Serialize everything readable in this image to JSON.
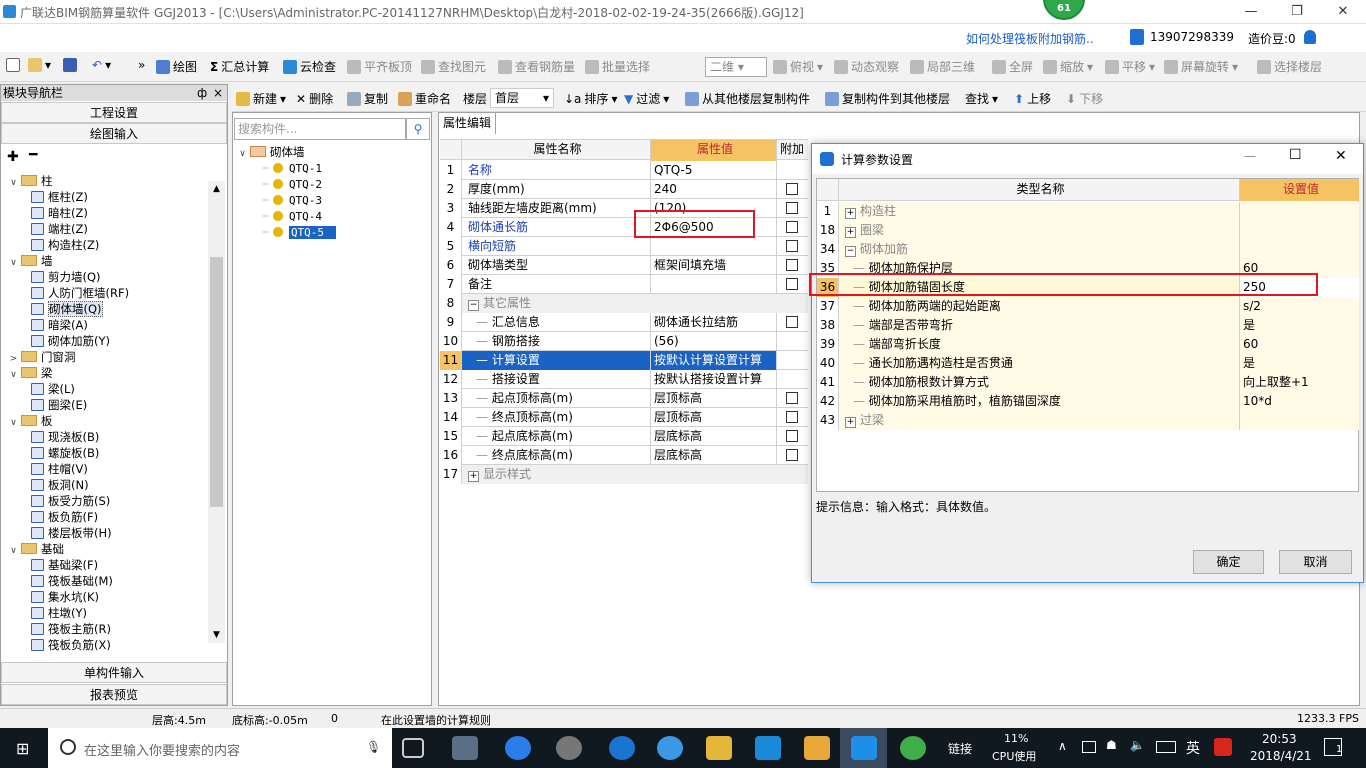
{
  "window": {
    "title": "广联达BIM钢筋算量软件 GGJ2013 - [C:\\Users\\Administrator.PC-20141127NRHM\\Desktop\\白龙村-2018-02-02-19-24-35(2666版).GGJ12]",
    "badge": "61"
  },
  "infobar": {
    "help_link": "如何处理筏板附加钢筋..",
    "phone": "13907298339",
    "bean": "造价豆:0"
  },
  "toolbar1": {
    "draw": "绘图",
    "sum_calc": "汇总计算",
    "cloud_check": "云检查",
    "flat_top": "平齐板顶",
    "find_element": "查找图元",
    "view_rebar": "查看钢筋量",
    "batch_select": "批量选择",
    "view_mode": "二维",
    "top_view": "俯视",
    "dynamic_view": "动态观察",
    "local_3d": "局部三维",
    "fullscreen": "全屏",
    "zoom": "缩放",
    "pan": "平移",
    "rotate": "屏幕旋转",
    "select_floor": "选择楼层"
  },
  "toolbar2": {
    "new": "新建",
    "delete": "删除",
    "copy": "复制",
    "rename": "重命名",
    "floor_label": "楼层",
    "floor_value": "首层",
    "sort": "排序",
    "filter": "过滤",
    "copy_from": "从其他楼层复制构件",
    "copy_to": "复制构件到其他楼层",
    "find": "查找",
    "move_up": "上移",
    "move_down": "下移"
  },
  "nav": {
    "header": "模块导航栏",
    "pin": "ф",
    "close": "×",
    "project_settings": "工程设置",
    "drawing_input": "绘图输入",
    "single_input": "单构件输入",
    "report_preview": "报表预览",
    "tree": [
      {
        "level": 0,
        "exp": "∨",
        "label": "柱",
        "folder": true
      },
      {
        "level": 1,
        "label": "框柱(Z)"
      },
      {
        "level": 1,
        "label": "暗柱(Z)"
      },
      {
        "level": 1,
        "label": "端柱(Z)"
      },
      {
        "level": 1,
        "label": "构造柱(Z)"
      },
      {
        "level": 0,
        "exp": "∨",
        "label": "墙",
        "folder": true
      },
      {
        "level": 1,
        "label": "剪力墙(Q)"
      },
      {
        "level": 1,
        "label": "人防门框墙(RF)"
      },
      {
        "level": 1,
        "label": "砌体墙(Q)",
        "selected": true
      },
      {
        "level": 1,
        "label": "暗梁(A)"
      },
      {
        "level": 1,
        "label": "砌体加筋(Y)"
      },
      {
        "level": 0,
        "exp": ">",
        "label": "门窗洞",
        "folder": true
      },
      {
        "level": 0,
        "exp": "∨",
        "label": "梁",
        "folder": true
      },
      {
        "level": 1,
        "label": "梁(L)"
      },
      {
        "level": 1,
        "label": "圈梁(E)"
      },
      {
        "level": 0,
        "exp": "∨",
        "label": "板",
        "folder": true
      },
      {
        "level": 1,
        "label": "现浇板(B)"
      },
      {
        "level": 1,
        "label": "螺旋板(B)"
      },
      {
        "level": 1,
        "label": "柱帽(V)"
      },
      {
        "level": 1,
        "label": "板洞(N)"
      },
      {
        "level": 1,
        "label": "板受力筋(S)"
      },
      {
        "level": 1,
        "label": "板负筋(F)"
      },
      {
        "level": 1,
        "label": "楼层板带(H)"
      },
      {
        "level": 0,
        "exp": "∨",
        "label": "基础",
        "folder": true
      },
      {
        "level": 1,
        "label": "基础梁(F)"
      },
      {
        "level": 1,
        "label": "筏板基础(M)"
      },
      {
        "level": 1,
        "label": "集水坑(K)"
      },
      {
        "level": 1,
        "label": "柱墩(Y)"
      },
      {
        "level": 1,
        "label": "筏板主筋(R)"
      },
      {
        "level": 1,
        "label": "筏板负筋(X)"
      }
    ]
  },
  "components": {
    "search_placeholder": "搜索构件...",
    "root": "砌体墙",
    "items": [
      "QTQ-1",
      "QTQ-2",
      "QTQ-3",
      "QTQ-4",
      "QTQ-5"
    ],
    "selected_index": 4
  },
  "props": {
    "tab": "属性编辑",
    "headers": {
      "name": "属性名称",
      "value": "属性值",
      "extra": "附加"
    },
    "rows": [
      {
        "n": "1",
        "name": "名称",
        "value": "QTQ-5",
        "blue": true,
        "chk": false
      },
      {
        "n": "2",
        "name": "厚度(mm)",
        "value": "240",
        "chk": true
      },
      {
        "n": "3",
        "name": "轴线距左墙皮距离(mm)",
        "value": "(120)",
        "chk": true
      },
      {
        "n": "4",
        "name": "砌体通长筋",
        "value": "2Φ6@500",
        "blue": true,
        "chk": true
      },
      {
        "n": "5",
        "name": "横向短筋",
        "value": "",
        "blue": true,
        "chk": true
      },
      {
        "n": "6",
        "name": "砌体墙类型",
        "value": "框架间填充墙",
        "chk": true
      },
      {
        "n": "7",
        "name": "备注",
        "value": "",
        "chk": true
      },
      {
        "n": "8",
        "name": "其它属性",
        "value": "",
        "group": true,
        "exp": "−"
      },
      {
        "n": "9",
        "name": "汇总信息",
        "value": "砌体通长拉结筋",
        "indent": true,
        "chk": true
      },
      {
        "n": "10",
        "name": "钢筋搭接",
        "value": "(56)",
        "indent": true
      },
      {
        "n": "11",
        "name": "计算设置",
        "value": "按默认计算设置计算",
        "indent": true,
        "active": true
      },
      {
        "n": "12",
        "name": "搭接设置",
        "value": "按默认搭接设置计算",
        "indent": true
      },
      {
        "n": "13",
        "name": "起点顶标高(m)",
        "value": "层顶标高",
        "indent": true,
        "chk": true
      },
      {
        "n": "14",
        "name": "终点顶标高(m)",
        "value": "层顶标高",
        "indent": true,
        "chk": true
      },
      {
        "n": "15",
        "name": "起点底标高(m)",
        "value": "层底标高",
        "indent": true,
        "chk": true
      },
      {
        "n": "16",
        "name": "终点底标高(m)",
        "value": "层底标高",
        "indent": true,
        "chk": true
      },
      {
        "n": "17",
        "name": "显示样式",
        "value": "",
        "group": true,
        "exp": "+"
      }
    ]
  },
  "dialog": {
    "title": "计算参数设置",
    "headers": {
      "type_name": "类型名称",
      "value": "设置值"
    },
    "rows": [
      {
        "n": "1",
        "name": "构造柱",
        "value": "",
        "group": true,
        "exp": "+"
      },
      {
        "n": "18",
        "name": "圈梁",
        "value": "",
        "group": true,
        "exp": "+"
      },
      {
        "n": "34",
        "name": "砌体加筋",
        "value": "",
        "group": true,
        "exp": "−"
      },
      {
        "n": "35",
        "name": "砌体加筋保护层",
        "value": "60"
      },
      {
        "n": "36",
        "name": "砌体加筋锚固长度",
        "value": "250",
        "active": true
      },
      {
        "n": "37",
        "name": "砌体加筋两端的起始距离",
        "value": "s/2"
      },
      {
        "n": "38",
        "name": "端部是否带弯折",
        "value": "是"
      },
      {
        "n": "39",
        "name": "端部弯折长度",
        "value": "60"
      },
      {
        "n": "40",
        "name": "通长加筋遇构造柱是否贯通",
        "value": "是"
      },
      {
        "n": "41",
        "name": "砌体加筋根数计算方式",
        "value": "向上取整+1"
      },
      {
        "n": "42",
        "name": "砌体加筋采用植筋时，植筋锚固深度",
        "value": "10*d"
      },
      {
        "n": "43",
        "name": "过梁",
        "value": "",
        "group": true,
        "exp": "+"
      }
    ],
    "hint": "提示信息：输入格式：具体数值。",
    "ok": "确定",
    "cancel": "取消"
  },
  "status": {
    "floor_height": "层高:4.5m",
    "bottom_elev": "底标高:-0.05m",
    "zero": "0",
    "message": "在此设置墙的计算规则",
    "fps": "1233.3 FPS"
  },
  "taskbar": {
    "search_placeholder": "在这里输入你要搜索的内容",
    "link": "链接",
    "cpu": "11%",
    "cpu_label": "CPU使用",
    "ime": "英",
    "time": "20:53",
    "date": "2018/4/21",
    "notif": "1"
  }
}
